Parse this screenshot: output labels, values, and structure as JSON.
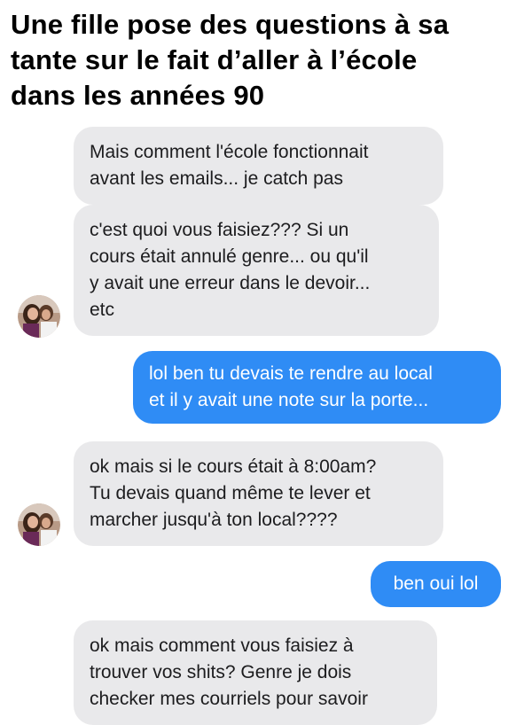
{
  "headline": {
    "lines": [
      "Une fille pose des questions à sa",
      "tante sur le fait d’aller à l’école",
      "dans les années 90"
    ]
  },
  "messages": [
    {
      "side": "in",
      "lines": [
        "Mais comment l'école fonctionnait",
        "avant les emails... je catch pas"
      ]
    },
    {
      "side": "in",
      "lines": [
        "c'est quoi vous faisiez??? Si un",
        "cours était annulé genre... ou qu'il",
        "y avait une erreur dans le devoir...",
        "etc"
      ]
    },
    {
      "side": "out",
      "lines": [
        "lol ben tu devais te rendre au local",
        "et il y avait une note sur la porte..."
      ]
    },
    {
      "side": "in",
      "lines": [
        "ok mais si le cours était à 8:00am?",
        "Tu devais quand même te lever et",
        "marcher jusqu'à ton local????"
      ]
    },
    {
      "side": "out",
      "lines": [
        "ben oui lol"
      ]
    },
    {
      "side": "in",
      "lines": [
        "ok mais comment vous faisiez à",
        "trouver vos shits? Genre je dois",
        "checker mes courriels pour savoir"
      ]
    }
  ],
  "colors": {
    "incoming_bubble": "#e9e9eb",
    "outgoing_bubble": "#2f8cf5",
    "outgoing_text": "#ffffff",
    "incoming_text": "#1c1c1e"
  },
  "avatar": {
    "icon": "profile-photo"
  }
}
